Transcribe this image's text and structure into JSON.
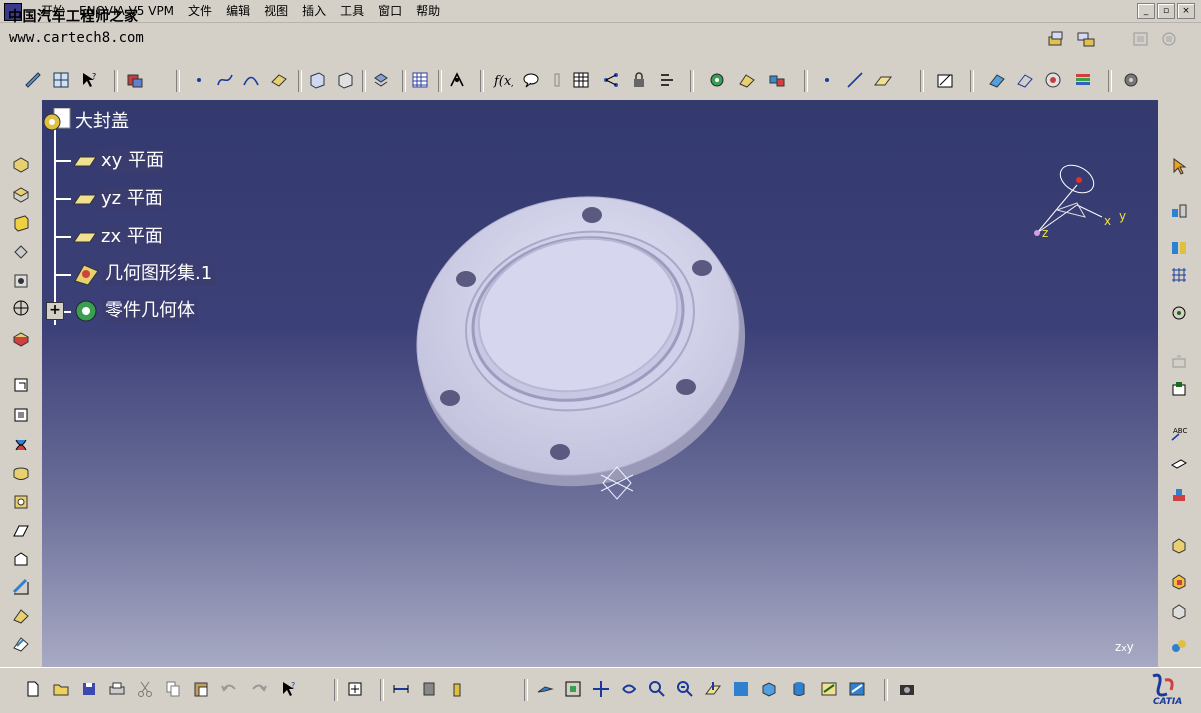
{
  "watermark": {
    "site_name": "中国汽车工程师之家",
    "url": "www.cartech8.com"
  },
  "menu": {
    "items": [
      "开始",
      "ENOVIA V5 VPM",
      "文件",
      "编辑",
      "视图",
      "插入",
      "工具",
      "窗口",
      "帮助"
    ]
  },
  "window_controls": {
    "minimize": "_",
    "restore": "▫",
    "close": "×"
  },
  "tree": {
    "root": "大封盖",
    "items": [
      "xy 平面",
      "yz 平面",
      "zx 平面",
      "几何图形集.1",
      "零件几何体"
    ],
    "expand_symbol": "+"
  },
  "compass": {
    "x": "x",
    "y": "y",
    "z": "z"
  },
  "mini_axis": {
    "label": "z",
    "label2": "x",
    "label3": "y"
  },
  "colors": {
    "viewport_top": "#333a6e",
    "viewport_bottom": "#a8aac4",
    "part_face": "#d8d8f0",
    "part_edge": "#b0b0cc",
    "ui_gray": "#d4d0c8"
  }
}
